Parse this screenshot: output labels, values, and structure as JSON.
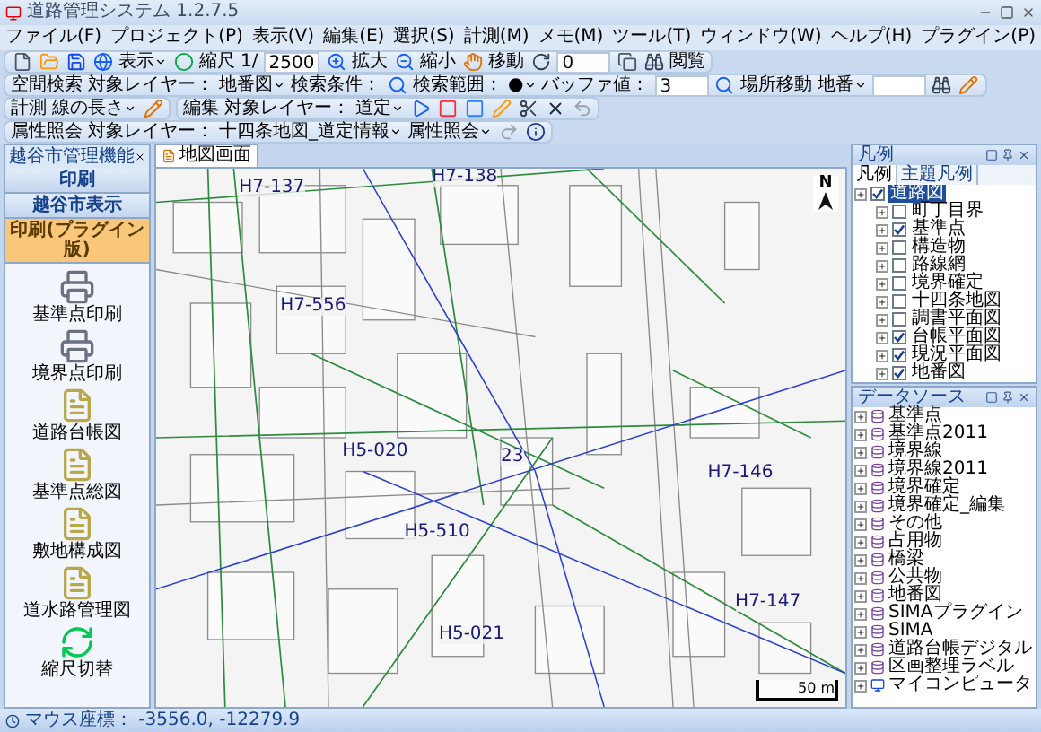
{
  "window": {
    "title": "道路管理システム 1.2.7.5"
  },
  "menu": [
    {
      "label": "ファイル(F)"
    },
    {
      "label": "プロジェクト(P)"
    },
    {
      "label": "表示(V)"
    },
    {
      "label": "編集(E)"
    },
    {
      "label": "選択(S)"
    },
    {
      "label": "計測(M)"
    },
    {
      "label": "メモ(M)"
    },
    {
      "label": "ツール(T)"
    },
    {
      "label": "ウィンドウ(W)"
    },
    {
      "label": "ヘルプ(H)"
    },
    {
      "label": "プラグイン(P)"
    }
  ],
  "toolbars": [
    {
      "items": [
        {
          "kind": "tool"
        },
        {
          "kind": "tool"
        },
        {
          "kind": "tool"
        },
        {
          "kind": "tool"
        },
        {
          "kind": "dropdown",
          "text": "表示"
        },
        {
          "kind": "tool"
        },
        {
          "kind": "label",
          "text": "縮尺"
        },
        {
          "kind": "label",
          "text": "1/"
        },
        {
          "kind": "field",
          "text": "2500"
        },
        {
          "kind": "tool"
        },
        {
          "kind": "label",
          "text": "拡大"
        },
        {
          "kind": "tool"
        },
        {
          "kind": "label",
          "text": "縮小"
        },
        {
          "kind": "tool"
        },
        {
          "kind": "label",
          "text": "移動"
        },
        {
          "kind": "tool"
        },
        {
          "kind": "field",
          "text": "0"
        },
        {
          "kind": "tool"
        },
        {
          "kind": "tool"
        },
        {
          "kind": "label",
          "text": "閲覧"
        }
      ]
    },
    {
      "items": [
        {
          "kind": "label",
          "text": "空間検索"
        },
        {
          "kind": "label",
          "text": "対象レイヤー："
        },
        {
          "kind": "dropdown",
          "text": "地番図"
        },
        {
          "kind": "label",
          "text": "検索条件："
        },
        {
          "kind": "tool"
        },
        {
          "kind": "label",
          "text": "検索範囲："
        },
        {
          "kind": "dropdown",
          "text": "●"
        },
        {
          "kind": "label",
          "text": "バッファ値："
        },
        {
          "kind": "field",
          "text": "3"
        },
        {
          "kind": "tool"
        },
        {
          "kind": "label",
          "text": "場所移動"
        },
        {
          "kind": "dropdown",
          "text": "地番"
        },
        {
          "kind": "field"
        },
        {
          "kind": "tool"
        },
        {
          "kind": "tool"
        }
      ]
    },
    {
      "items": [
        {
          "kind": "label",
          "text": "計測"
        },
        {
          "kind": "dropdown",
          "text": "線の長さ"
        },
        {
          "kind": "tool"
        }
      ]
    },
    {
      "items": [
        {
          "kind": "label",
          "text": "編集"
        },
        {
          "kind": "label",
          "text": "対象レイヤー："
        },
        {
          "kind": "dropdown",
          "text": "道定"
        },
        {
          "kind": "tool"
        },
        {
          "kind": "tool"
        },
        {
          "kind": "tool"
        },
        {
          "kind": "tool"
        },
        {
          "kind": "tool"
        },
        {
          "kind": "tool"
        },
        {
          "kind": "tool"
        }
      ]
    },
    {
      "items": [
        {
          "kind": "label",
          "text": "属性照会"
        },
        {
          "kind": "label",
          "text": "対象レイヤー："
        },
        {
          "kind": "dropdown",
          "text": "十四条地図_道定情報"
        },
        {
          "kind": "dropdown",
          "text": "属性照会"
        },
        {
          "kind": "tool"
        },
        {
          "kind": "tool"
        }
      ]
    }
  ],
  "left_panel": {
    "title": "越谷市管理機能",
    "buttons": [
      {
        "label": "印刷",
        "selected": false
      },
      {
        "label": "越谷市表示",
        "selected": false
      },
      {
        "label": "印刷(プラグイン版)",
        "selected": true
      }
    ],
    "items": [
      {
        "label": "基準点印刷",
        "kind": "printer"
      },
      {
        "label": "境界点印刷",
        "kind": "printer"
      },
      {
        "label": "道路台帳図",
        "kind": "document"
      },
      {
        "label": "基準点総図",
        "kind": "document"
      },
      {
        "label": "敷地構成図",
        "kind": "document"
      },
      {
        "label": "道水路管理図",
        "kind": "document"
      },
      {
        "label": "縮尺切替",
        "kind": "refresh"
      }
    ]
  },
  "map": {
    "tab": "地図画面",
    "labels": [
      {
        "text": "H7-137"
      },
      {
        "text": "H7-138"
      },
      {
        "text": "H7-556"
      },
      {
        "text": "H5-020"
      },
      {
        "text": "23"
      },
      {
        "text": "H5-510"
      },
      {
        "text": "H5-021"
      },
      {
        "text": "H7-146"
      },
      {
        "text": "H7-147"
      }
    ],
    "north": "N",
    "scale": "50 m"
  },
  "legend": {
    "title": "凡例",
    "tabs": [
      {
        "label": "凡例",
        "selected": true
      },
      {
        "label": "主題凡例",
        "selected": false
      }
    ],
    "tree": [
      {
        "label": "道路図",
        "checked": true,
        "selected": true,
        "children": [
          {
            "label": "町丁目界",
            "checked": false,
            "selected": false
          },
          {
            "label": "基準点",
            "checked": true,
            "selected": false
          },
          {
            "label": "構造物",
            "checked": false,
            "selected": false
          },
          {
            "label": "路線網",
            "checked": false,
            "selected": false
          },
          {
            "label": "境界確定",
            "checked": false,
            "selected": false
          },
          {
            "label": "十四条地図",
            "checked": false,
            "selected": false
          },
          {
            "label": "調書平面図",
            "checked": false,
            "selected": false
          },
          {
            "label": "台帳平面図",
            "checked": true,
            "selected": false
          },
          {
            "label": "現況平面図",
            "checked": true,
            "selected": false
          },
          {
            "label": "地番図",
            "checked": true,
            "selected": false
          }
        ]
      }
    ]
  },
  "datasource": {
    "title": "データソース",
    "items": [
      {
        "label": "基準点",
        "kind": "layer"
      },
      {
        "label": "基準点2011",
        "kind": "layer"
      },
      {
        "label": "境界線",
        "kind": "layer"
      },
      {
        "label": "境界線2011",
        "kind": "layer"
      },
      {
        "label": "境界確定",
        "kind": "layer"
      },
      {
        "label": "境界確定_編集",
        "kind": "layer"
      },
      {
        "label": "その他",
        "kind": "layer"
      },
      {
        "label": "占用物",
        "kind": "layer"
      },
      {
        "label": "橋梁",
        "kind": "layer"
      },
      {
        "label": "公共物",
        "kind": "layer"
      },
      {
        "label": "地番図",
        "kind": "layer"
      },
      {
        "label": "SIMAプラグイン",
        "kind": "layer"
      },
      {
        "label": "SIMA",
        "kind": "layer"
      },
      {
        "label": "道路台帳デジタル",
        "kind": "layer"
      },
      {
        "label": "区画整理ラベル",
        "kind": "layer"
      },
      {
        "label": "マイコンピュータ",
        "kind": "computer"
      }
    ]
  },
  "status_bar": {
    "text": "マウス座標： -3556.0, -12279.9"
  }
}
